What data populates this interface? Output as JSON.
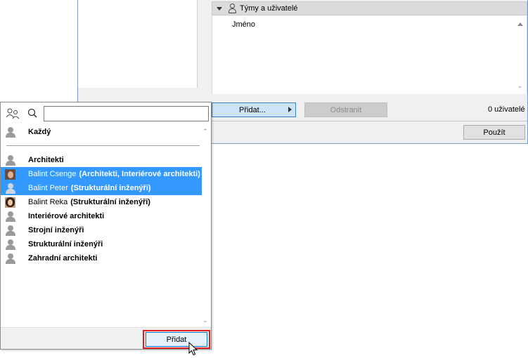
{
  "background_dialog": {
    "section_title": "Týmy a uživatelé",
    "column_header": "Jméno",
    "add_button_label": "Přidat...",
    "remove_button_label": "Odstranit",
    "user_count": "0 uživatelé",
    "apply_button_label": "Použít"
  },
  "popup": {
    "search": {
      "value": "",
      "placeholder": ""
    },
    "everyone": {
      "label": "Každý",
      "avatar": "generic-user-icon"
    },
    "items": [
      {
        "name": "Architekti",
        "group": "",
        "bold": true,
        "selected": false,
        "avatar": "generic-user-icon"
      },
      {
        "name": "Balint Csenge",
        "group": "(Architekti, Interiérové architekti)",
        "bold": false,
        "selected": true,
        "avatar": "user-photo-man"
      },
      {
        "name": "Balint Peter",
        "group": "(Strukturální inženýři)",
        "bold": false,
        "selected": true,
        "avatar": "generic-user-icon"
      },
      {
        "name": "Balint Reka",
        "group": "(Strukturální inženýři)",
        "bold": false,
        "selected": false,
        "avatar": "user-photo-woman"
      },
      {
        "name": "Interiérové architekti",
        "group": "",
        "bold": true,
        "selected": false,
        "avatar": "generic-user-icon"
      },
      {
        "name": "Strojní inženýři",
        "group": "",
        "bold": true,
        "selected": false,
        "avatar": "generic-user-icon"
      },
      {
        "name": "Strukturální inženýři",
        "group": "",
        "bold": true,
        "selected": false,
        "avatar": "generic-user-icon"
      },
      {
        "name": "Zahradní architekti",
        "group": "",
        "bold": true,
        "selected": false,
        "avatar": "generic-user-icon"
      }
    ],
    "add_button_label": "Přidat"
  },
  "colors": {
    "selection": "#3399ff",
    "highlight_border": "#e02020",
    "primary_button": "#e5f1fb",
    "dialog_border": "#7a9cc7"
  }
}
